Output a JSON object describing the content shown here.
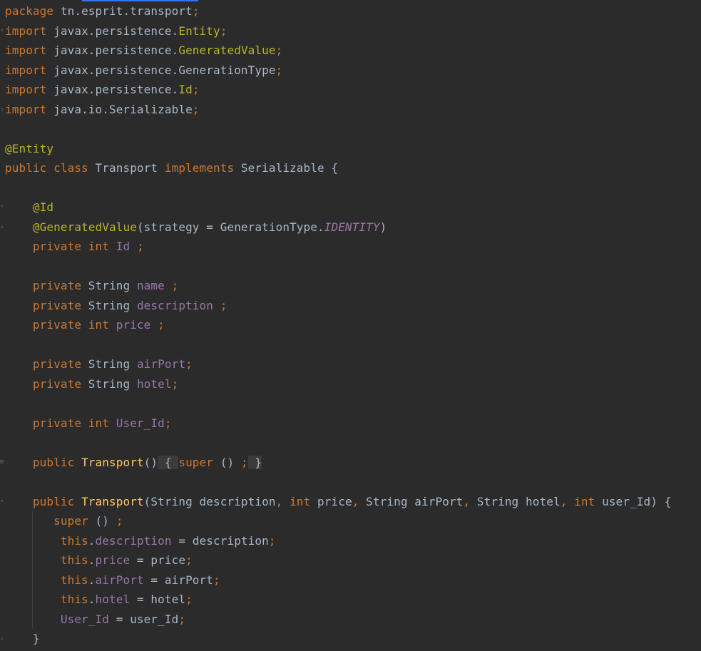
{
  "editor": {
    "lines": [
      [
        {
          "t": "package ",
          "c": "kw"
        },
        {
          "t": "tn.esprit.transport",
          "c": "plain"
        },
        {
          "t": ";",
          "c": "kw"
        }
      ],
      [
        {
          "t": "import ",
          "c": "kw"
        },
        {
          "t": "javax.persistence.",
          "c": "plain"
        },
        {
          "t": "Entity",
          "c": "ann"
        },
        {
          "t": ";",
          "c": "kw"
        }
      ],
      [
        {
          "t": "import ",
          "c": "kw"
        },
        {
          "t": "javax.persistence.",
          "c": "plain"
        },
        {
          "t": "GeneratedValue",
          "c": "ann"
        },
        {
          "t": ";",
          "c": "kw"
        }
      ],
      [
        {
          "t": "import ",
          "c": "kw"
        },
        {
          "t": "javax.persistence.GenerationType",
          "c": "plain"
        },
        {
          "t": ";",
          "c": "kw"
        }
      ],
      [
        {
          "t": "import ",
          "c": "kw"
        },
        {
          "t": "javax.persistence.",
          "c": "plain"
        },
        {
          "t": "Id",
          "c": "ann"
        },
        {
          "t": ";",
          "c": "kw"
        }
      ],
      [
        {
          "t": "import ",
          "c": "kw"
        },
        {
          "t": "java.io.Serializable",
          "c": "plain"
        },
        {
          "t": ";",
          "c": "kw"
        }
      ],
      [],
      [
        {
          "t": "@Entity",
          "c": "ann"
        }
      ],
      [
        {
          "t": "public class ",
          "c": "kw"
        },
        {
          "t": "Transport ",
          "c": "plain"
        },
        {
          "t": "implements ",
          "c": "kw"
        },
        {
          "t": "Serializable {",
          "c": "plain"
        }
      ],
      [],
      [
        {
          "t": "    @Id",
          "c": "ann"
        }
      ],
      [
        {
          "t": "    @GeneratedValue",
          "c": "ann"
        },
        {
          "t": "(strategy = GenerationType.",
          "c": "plain"
        },
        {
          "t": "IDENTITY",
          "c": "it"
        },
        {
          "t": ")",
          "c": "plain"
        }
      ],
      [
        {
          "t": "    private int ",
          "c": "kw"
        },
        {
          "t": "Id ",
          "c": "fld"
        },
        {
          "t": ";",
          "c": "kw"
        }
      ],
      [],
      [
        {
          "t": "    private ",
          "c": "kw"
        },
        {
          "t": "String ",
          "c": "plain"
        },
        {
          "t": "name ",
          "c": "fld"
        },
        {
          "t": ";",
          "c": "kw"
        }
      ],
      [
        {
          "t": "    private ",
          "c": "kw"
        },
        {
          "t": "String ",
          "c": "plain"
        },
        {
          "t": "description ",
          "c": "fld"
        },
        {
          "t": ";",
          "c": "kw"
        }
      ],
      [
        {
          "t": "    private int ",
          "c": "kw"
        },
        {
          "t": "price ",
          "c": "fld"
        },
        {
          "t": ";",
          "c": "kw"
        }
      ],
      [],
      [
        {
          "t": "    private ",
          "c": "kw"
        },
        {
          "t": "String ",
          "c": "plain"
        },
        {
          "t": "airPort",
          "c": "fld"
        },
        {
          "t": ";",
          "c": "kw"
        }
      ],
      [
        {
          "t": "    private ",
          "c": "kw"
        },
        {
          "t": "String ",
          "c": "plain"
        },
        {
          "t": "hotel",
          "c": "fld"
        },
        {
          "t": ";",
          "c": "kw"
        }
      ],
      [],
      [
        {
          "t": "    private int ",
          "c": "kw"
        },
        {
          "t": "User_Id",
          "c": "fld"
        },
        {
          "t": ";",
          "c": "kw"
        }
      ],
      [],
      [
        {
          "t": "    public ",
          "c": "kw"
        },
        {
          "t": "Transport",
          "c": "mth"
        },
        {
          "t": "()",
          "c": "plain"
        },
        {
          "t": " { ",
          "c": "brace-hl"
        },
        {
          "t": "super ",
          "c": "kw"
        },
        {
          "t": "() ",
          "c": "plain"
        },
        {
          "t": ";",
          "c": "kw"
        },
        {
          "t": " }",
          "c": "brace-hl"
        }
      ],
      [],
      [
        {
          "t": "    public ",
          "c": "kw"
        },
        {
          "t": "Transport",
          "c": "mth"
        },
        {
          "t": "(String description",
          "c": "plain"
        },
        {
          "t": ", int ",
          "c": "kw"
        },
        {
          "t": "price",
          "c": "plain"
        },
        {
          "t": ", ",
          "c": "kw"
        },
        {
          "t": "String airPort",
          "c": "plain"
        },
        {
          "t": ", ",
          "c": "kw"
        },
        {
          "t": "String hotel",
          "c": "plain"
        },
        {
          "t": ", int ",
          "c": "kw"
        },
        {
          "t": "user_Id) {",
          "c": "plain"
        }
      ],
      [
        {
          "t": "       super ",
          "c": "kw"
        },
        {
          "t": "() ",
          "c": "plain"
        },
        {
          "t": ";",
          "c": "kw"
        }
      ],
      [
        {
          "t": "        this",
          "c": "kw"
        },
        {
          "t": ".",
          "c": "plain"
        },
        {
          "t": "description",
          "c": "fld"
        },
        {
          "t": " = description",
          "c": "plain"
        },
        {
          "t": ";",
          "c": "kw"
        }
      ],
      [
        {
          "t": "        this",
          "c": "kw"
        },
        {
          "t": ".",
          "c": "plain"
        },
        {
          "t": "price",
          "c": "fld"
        },
        {
          "t": " = price",
          "c": "plain"
        },
        {
          "t": ";",
          "c": "kw"
        }
      ],
      [
        {
          "t": "        this",
          "c": "kw"
        },
        {
          "t": ".",
          "c": "plain"
        },
        {
          "t": "airPort",
          "c": "fld"
        },
        {
          "t": " = airPort",
          "c": "plain"
        },
        {
          "t": ";",
          "c": "kw"
        }
      ],
      [
        {
          "t": "        this",
          "c": "kw"
        },
        {
          "t": ".",
          "c": "plain"
        },
        {
          "t": "hotel",
          "c": "fld"
        },
        {
          "t": " = hotel",
          "c": "plain"
        },
        {
          "t": ";",
          "c": "kw"
        }
      ],
      [
        {
          "t": "        User_Id",
          "c": "fld"
        },
        {
          "t": " = user_Id",
          "c": "plain"
        },
        {
          "t": ";",
          "c": "kw"
        }
      ],
      [
        {
          "t": "    }",
          "c": "plain"
        }
      ]
    ],
    "colors": {
      "background": "#2b2b2b",
      "keyword": "#cc7832",
      "annotation": "#bbb529",
      "field": "#9876aa",
      "method": "#ffc66d",
      "text": "#a9b7c6"
    },
    "fold_markers": [
      "fold-icon",
      "fold-icon",
      "fold-icon",
      "fold-icon",
      "fold-icon",
      "fold-icon"
    ]
  }
}
